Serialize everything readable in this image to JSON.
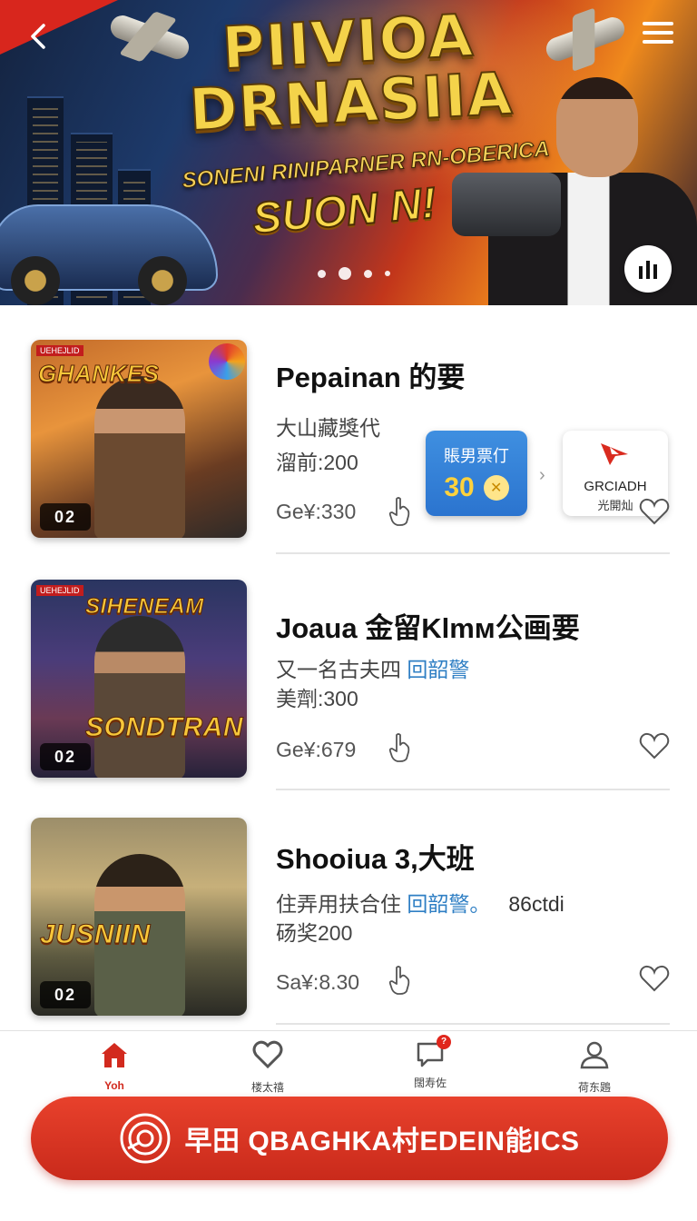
{
  "banner": {
    "title_line1": "PIIVIOA",
    "title_line2": "DRNASIIA",
    "subtitle": "SONENI RINIPARNER RN-OBERICA",
    "subtitle2": "SUON N!",
    "carousel_total": 4,
    "carousel_active": 2
  },
  "items": [
    {
      "title": "Pepainan 的要",
      "line1": "大山藏獎代",
      "line1_link": "",
      "line1_extra": "",
      "line2": "溜前:200",
      "price": "Ge¥:330",
      "thumb_logo": "GHANKES",
      "thumb_tag": "UEHEJLID",
      "thumb_num": "02",
      "promo": {
        "blue_label": "賬男票仃",
        "blue_value": "30",
        "coin_symbol": "✕",
        "white_name": "GRCIADH",
        "white_sub": "光開灿"
      }
    },
    {
      "title": "Joaua 金留Klmм公画要",
      "line1": "又一名古夫四 ",
      "line1_link": "回韶警",
      "line1_extra": "",
      "line2": "美劑:300",
      "price": "Ge¥:679",
      "thumb_logo": "SONDTRAN",
      "thumb_logo_top": "SIHENEAM",
      "thumb_tag": "UEHEJLID",
      "thumb_num": "02"
    },
    {
      "title": "Shooiua 3,大班",
      "line1": "住弄用扶合住 ",
      "line1_link": "回韶警。",
      "line1_extra": "86ctdi",
      "line2": "砀奖200",
      "price": "Sa¥:8.30",
      "thumb_logo": "JUSNIIN",
      "thumb_num": "02"
    }
  ],
  "tabs": [
    {
      "label": "Yoh",
      "icon": "home-icon",
      "active": true
    },
    {
      "label": "楼太禧",
      "icon": "heart-icon",
      "active": false
    },
    {
      "label": "闊寿佐",
      "icon": "chat-icon",
      "active": false,
      "badge": "?"
    },
    {
      "label": "荷东鶗",
      "icon": "user-icon",
      "active": false
    }
  ],
  "cta": {
    "label": "早田 QBAGHKA村EDEIN能ICS",
    "icon": "target-icon"
  },
  "colors": {
    "accent": "#d22a1e",
    "link": "#2f7fc4",
    "promo_blue": "#2b74cf"
  }
}
